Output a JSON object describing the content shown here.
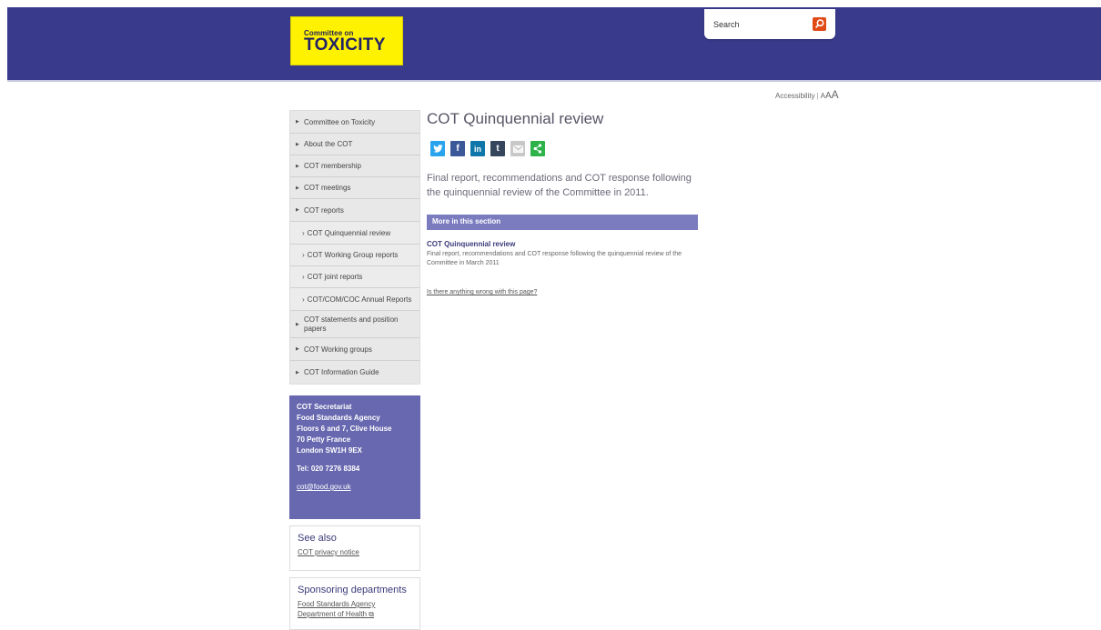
{
  "header": {
    "logo_small": "Committee on",
    "logo_big": "TOXICITY",
    "search_placeholder": "Search",
    "search_icon": "search-icon",
    "background_color": "#3a3a8c"
  },
  "accessibility": {
    "label": "Accessibility",
    "sizes": [
      "A",
      "A",
      "A"
    ]
  },
  "sidenav": {
    "items": [
      {
        "label": "Committee on Toxicity",
        "level": "top"
      },
      {
        "label": "About the COT",
        "level": "top"
      },
      {
        "label": "COT membership",
        "level": "top"
      },
      {
        "label": "COT meetings",
        "level": "top"
      },
      {
        "label": "COT reports",
        "level": "top"
      },
      {
        "label": "COT Quinquennial review",
        "level": "sub"
      },
      {
        "label": "COT Working Group reports",
        "level": "sub"
      },
      {
        "label": "COT joint reports",
        "level": "sub"
      },
      {
        "label": "COT/COM/COC Annual Reports",
        "level": "sub"
      },
      {
        "label": "COT statements and position papers",
        "level": "top"
      },
      {
        "label": "COT Working groups",
        "level": "top"
      },
      {
        "label": "COT Information Guide",
        "level": "top"
      }
    ]
  },
  "address": {
    "lines": [
      "COT Secretariat",
      "Food Standards Agency",
      "Floors 6 and 7, Clive House",
      "70 Petty France",
      "London SW1H 9EX"
    ],
    "tel": "Tel: 020 7276 8384",
    "email": "cot@food.gov.uk"
  },
  "see_also": {
    "heading": "See also",
    "links": [
      "COT privacy notice"
    ]
  },
  "sponsoring": {
    "heading": "Sponsoring departments",
    "links": [
      "Food Standards Agency",
      "Department of Health"
    ]
  },
  "main": {
    "title": "COT Quinquennial review",
    "share_icons": [
      {
        "name": "twitter-icon",
        "glyph": "t",
        "color": "#2aa3ef"
      },
      {
        "name": "facebook-icon",
        "glyph": "f",
        "color": "#3b5998"
      },
      {
        "name": "linkedin-icon",
        "glyph": "in",
        "color": "#0e76a8"
      },
      {
        "name": "tumblr-icon",
        "glyph": "t",
        "color": "#35465c"
      },
      {
        "name": "email-icon",
        "glyph": "✉",
        "color": "#c8c8c8"
      },
      {
        "name": "share-icon",
        "glyph": "<",
        "color": "#2db34a"
      }
    ],
    "intro": "Final report, recommendations and COT response following the quinquennial review of the Committee in 2011.",
    "section_heading": "More in this section",
    "item_title": "COT Quinquennial review",
    "item_desc": "Final report, recommendations and COT response following the quinquennial review of the Committee in March 2011",
    "wrong_link": "Is there anything wrong with this page?"
  }
}
